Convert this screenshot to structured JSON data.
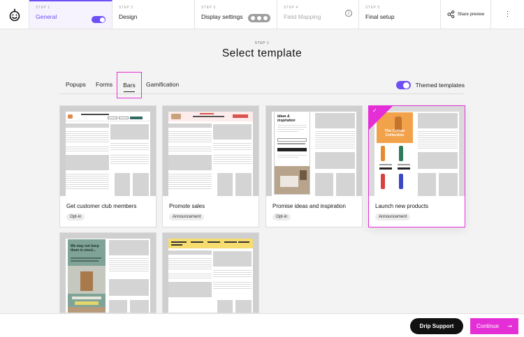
{
  "steps": [
    {
      "num": "STEP 1",
      "label": "General"
    },
    {
      "num": "STEP 2",
      "label": "Design"
    },
    {
      "num": "STEP 3",
      "label": "Display settings"
    },
    {
      "num": "STEP 4",
      "label": "Field Mapping"
    },
    {
      "num": "STEP 5",
      "label": "Final setup"
    }
  ],
  "share_label": "Share preview",
  "more_glyph": "⋮",
  "info_glyph": "i",
  "header": {
    "step": "STEP 1",
    "title": "Select template"
  },
  "tabs": [
    "Popups",
    "Forms",
    "Bars",
    "Gamification"
  ],
  "themed_label": "Themed templates",
  "cards": [
    {
      "title": "Get customer club members",
      "tag": "Opt-in"
    },
    {
      "title": "Promote sales",
      "tag": "Announcement"
    },
    {
      "title": "Promise ideas and inspiration",
      "tag": "Opt-in"
    },
    {
      "title": "Launch new products",
      "tag": "Announcement"
    }
  ],
  "thumb_text": {
    "ideas": "Ideas & inspiration",
    "collection": "The Colour Collection",
    "hoh": "We may not keep them in stock..."
  },
  "check_glyph": "✓",
  "bottom": {
    "support": "Drip Support",
    "continue": "Continue",
    "arrow": "→"
  },
  "colors": {
    "accent": "#6e4ef5",
    "highlight": "#e52fd6"
  }
}
